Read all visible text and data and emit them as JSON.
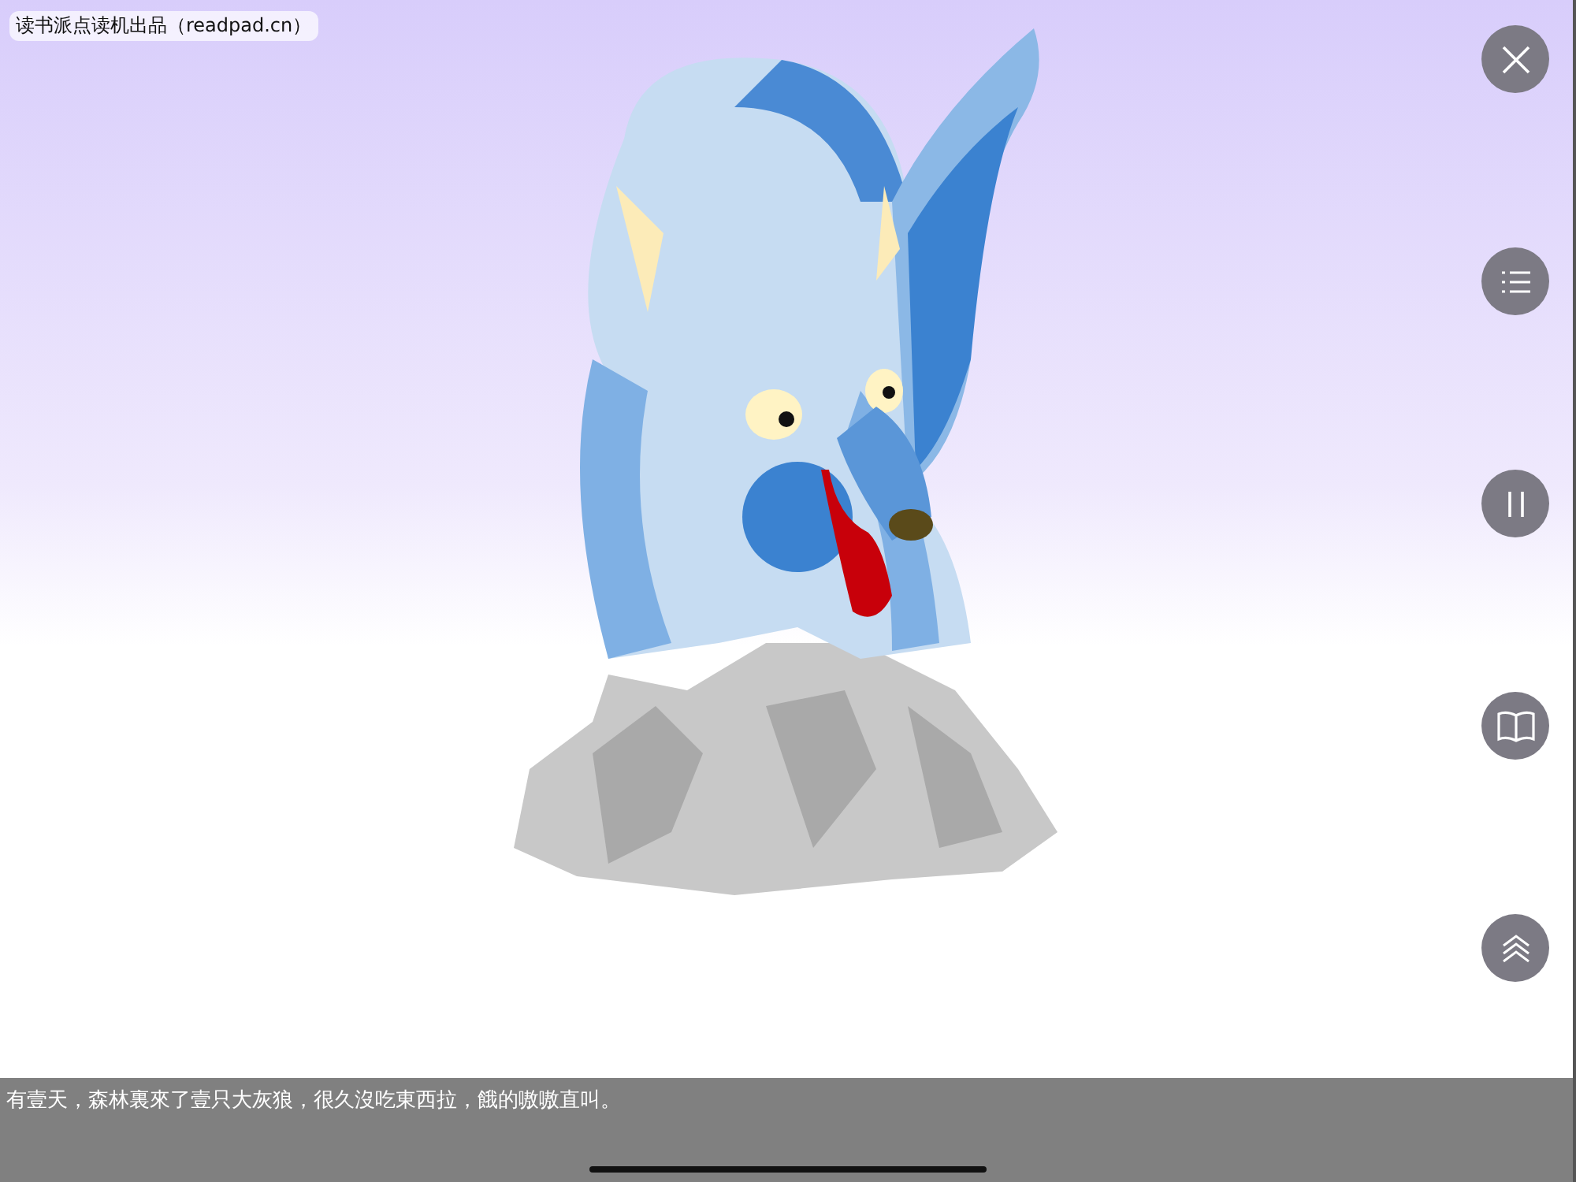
{
  "credit": "读书派点读机出品（readpad.cn）",
  "caption": "有壹天，森林裏來了壹只大灰狼，很久沒吃東西拉，餓的嗷嗷直叫。",
  "controls": [
    {
      "kind": "close"
    },
    {
      "kind": "menu"
    },
    {
      "kind": "pause"
    },
    {
      "kind": "book"
    },
    {
      "kind": "up"
    }
  ]
}
